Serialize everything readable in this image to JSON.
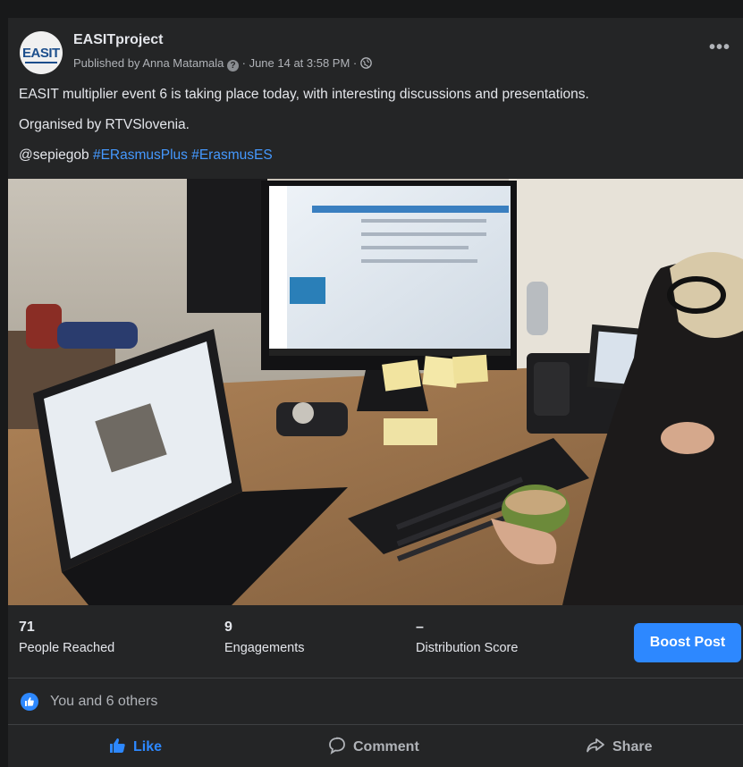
{
  "post": {
    "page_name": "EASITproject",
    "avatar_text": "EASIT",
    "meta_published": "Published by Anna Matamala",
    "meta_time": " · June 14 at 3:58 PM · ",
    "more_label": "•••",
    "text_line1": "EASIT multiplier event 6 is taking place today, with interesting discussions and presentations.",
    "text_line2": "Organised by RTVSlovenia.",
    "mention": "@sepiegob",
    "hashtags": [
      " #ERasmusPlus",
      " #ErasmusES"
    ]
  },
  "stats": [
    {
      "value": "71",
      "label": "People Reached"
    },
    {
      "value": "9",
      "label": "Engagements"
    },
    {
      "value": "–",
      "label": "Distribution Score"
    }
  ],
  "boost_label": "Boost Post",
  "reactions_text": "You and 6 others",
  "actions": {
    "like": "Like",
    "comment": "Comment",
    "share": "Share"
  },
  "colors": {
    "background": "#242526",
    "accent": "#2d88ff",
    "hashtag": "#4599ff",
    "text": "#e4e6eb",
    "muted": "#b0b3b8"
  }
}
